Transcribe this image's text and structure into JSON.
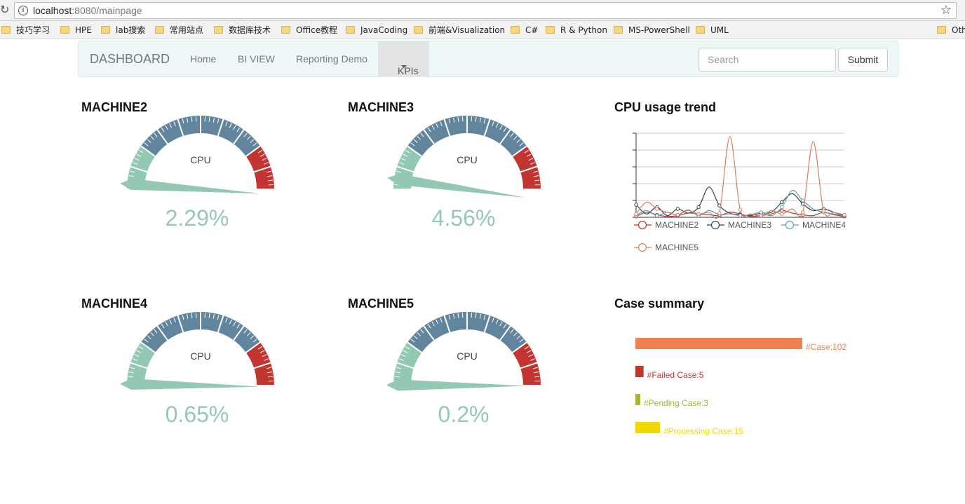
{
  "browser": {
    "url_host": "localhost",
    "url_path": ":8080/mainpage",
    "bookmarks": [
      "技巧学习",
      "HPE",
      "lab搜索",
      "常用站点",
      "数据库技术",
      "Office教程",
      "JavaCoding",
      "前端&Visualization",
      "C#",
      "R & Python",
      "MS-PowerShell",
      "UML",
      "Oth"
    ]
  },
  "navbar": {
    "brand": "DASHBOARD",
    "items": [
      "Home",
      "BI VIEW",
      "Reporting Demo"
    ],
    "active": "KPIs",
    "search_placeholder": "Search",
    "submit": "Submit"
  },
  "gauges": [
    {
      "name": "MACHINE2",
      "label": "CPU",
      "value_text": "2.29%",
      "value": 2.29
    },
    {
      "name": "MACHINE3",
      "label": "CPU",
      "value_text": "4.56%",
      "value": 4.56
    },
    {
      "name": "MACHINE4",
      "label": "CPU",
      "value_text": "0.65%",
      "value": 0.65
    },
    {
      "name": "MACHINE5",
      "label": "CPU",
      "value_text": "0.2%",
      "value": 0.2
    }
  ],
  "gauge_colors": {
    "low": "#93c9b2",
    "mid": "#62859e",
    "high": "#c23531"
  },
  "trend": {
    "title": "CPU usage trend",
    "chart_data": {
      "type": "line",
      "series": [
        {
          "name": "MACHINE2",
          "color": "#c23531",
          "values": [
            1,
            6,
            3,
            1,
            2,
            5,
            4,
            3,
            2,
            6,
            4,
            1,
            2,
            4,
            8,
            5,
            3,
            2,
            6,
            3,
            1
          ]
        },
        {
          "name": "MACHINE3",
          "color": "#2f4554",
          "values": [
            15,
            4,
            12,
            2,
            10,
            5,
            12,
            36,
            14,
            5,
            3,
            2,
            5,
            6,
            18,
            28,
            16,
            8,
            10,
            6,
            2
          ]
        },
        {
          "name": "MACHINE4",
          "color": "#61a0a8",
          "values": [
            2,
            8,
            2,
            6,
            3,
            9,
            2,
            8,
            3,
            4,
            2,
            3,
            6,
            2,
            12,
            32,
            20,
            10,
            6,
            4,
            2
          ]
        },
        {
          "name": "MACHINE5",
          "color": "#d48265",
          "values": [
            4,
            18,
            10,
            6,
            3,
            8,
            4,
            6,
            5,
            96,
            9,
            4,
            2,
            8,
            4,
            10,
            6,
            90,
            8,
            6,
            3
          ]
        }
      ],
      "ylim": [
        0,
        100
      ]
    }
  },
  "cases": {
    "title": "Case summary",
    "chart_data": {
      "type": "bar",
      "categories": [
        "#Case:102",
        "#Failed Case:5",
        "#Pending Case:3",
        "#Processing Case:15"
      ],
      "values": [
        102,
        5,
        3,
        15
      ],
      "colors": [
        "#f08050",
        "#c23531",
        "#a9b335",
        "#f0d800"
      ]
    }
  }
}
